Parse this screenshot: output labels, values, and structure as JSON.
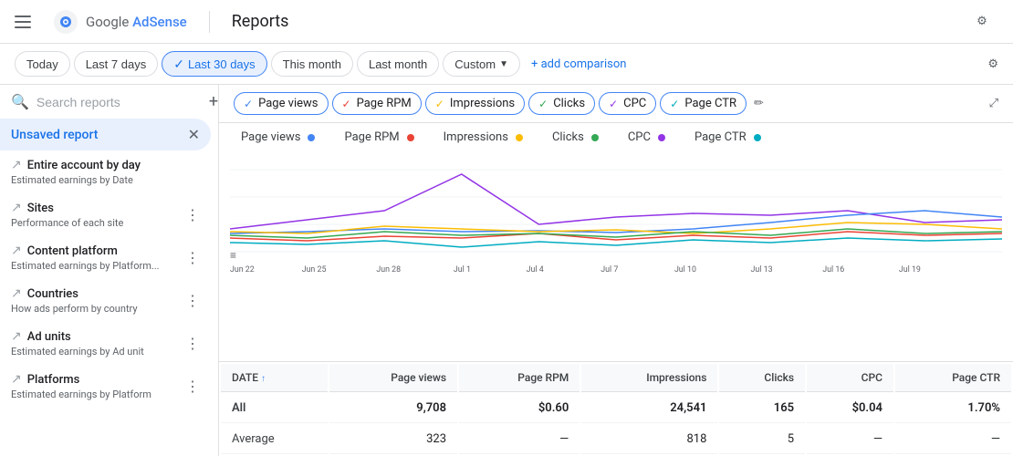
{
  "app": {
    "hamburger_label": "menu",
    "logo_text": "Google ",
    "brand_text": "AdSense",
    "divider": "|",
    "page_title": "Reports",
    "gear_icon": "⚙"
  },
  "date_filters": {
    "buttons": [
      {
        "id": "today",
        "label": "Today",
        "active": false
      },
      {
        "id": "last7",
        "label": "Last 7 days",
        "active": false
      },
      {
        "id": "last30",
        "label": "Last 30 days",
        "active": true
      },
      {
        "id": "thismonth",
        "label": "This month",
        "active": false
      },
      {
        "id": "lastmonth",
        "label": "Last month",
        "active": false
      },
      {
        "id": "custom",
        "label": "Custom",
        "active": false,
        "dropdown": true
      }
    ],
    "add_comparison": "+ add comparison",
    "gear_icon": "⚙"
  },
  "sidebar": {
    "search_placeholder": "Search reports",
    "add_icon": "+",
    "active_item": {
      "label": "Unsaved report",
      "close_icon": "✕"
    },
    "items": [
      {
        "id": "entire-account",
        "name": "Entire account by day",
        "desc": "Estimated earnings by Date",
        "icon": "↗"
      },
      {
        "id": "sites",
        "name": "Sites",
        "desc": "Performance of each site",
        "icon": "↗"
      },
      {
        "id": "content-platform",
        "name": "Content platform",
        "desc": "Estimated earnings by Platform...",
        "icon": "↗"
      },
      {
        "id": "countries",
        "name": "Countries",
        "desc": "How ads perform by country",
        "icon": "↗"
      },
      {
        "id": "ad-units",
        "name": "Ad units",
        "desc": "Estimated earnings by Ad unit",
        "icon": "↗"
      },
      {
        "id": "platforms",
        "name": "Platforms",
        "desc": "Estimated earnings by Platform",
        "icon": "↗"
      }
    ],
    "three_dots": "⋮"
  },
  "metrics": {
    "tabs": [
      {
        "id": "pageviews",
        "label": "Page views",
        "color": "#4285f4",
        "active": true
      },
      {
        "id": "pagerpm",
        "label": "Page RPM",
        "color": "#ea4335",
        "active": true
      },
      {
        "id": "impressions",
        "label": "Impressions",
        "color": "#fbbc04",
        "active": true
      },
      {
        "id": "clicks",
        "label": "Clicks",
        "color": "#34a853",
        "active": true
      },
      {
        "id": "cpc",
        "label": "CPC",
        "color": "#9334e6",
        "active": true
      },
      {
        "id": "pagectr",
        "label": "Page CTR",
        "color": "#00acc1",
        "active": true
      }
    ],
    "edit_icon": "✏",
    "expand_icon": "⤢"
  },
  "chart": {
    "x_labels": [
      "Jun 22",
      "Jun 25",
      "Jun 28",
      "Jul 1",
      "Jul 4",
      "Jul 7",
      "Jul 10",
      "Jul 13",
      "Jul 16",
      "Jul 19"
    ],
    "align_icon": "≡"
  },
  "table": {
    "columns": [
      "DATE",
      "Page views",
      "Page RPM",
      "Impressions",
      "Clicks",
      "CPC",
      "Page CTR"
    ],
    "rows": [
      {
        "date": "All",
        "pageviews": "9,708",
        "pagerpm": "$0.60",
        "impressions": "24,541",
        "clicks": "165",
        "cpc": "$0.04",
        "pagectr": "1.70%"
      },
      {
        "date": "Average",
        "pageviews": "323",
        "pagerpm": "—",
        "impressions": "818",
        "clicks": "5",
        "cpc": "—",
        "pagectr": "—"
      }
    ]
  }
}
